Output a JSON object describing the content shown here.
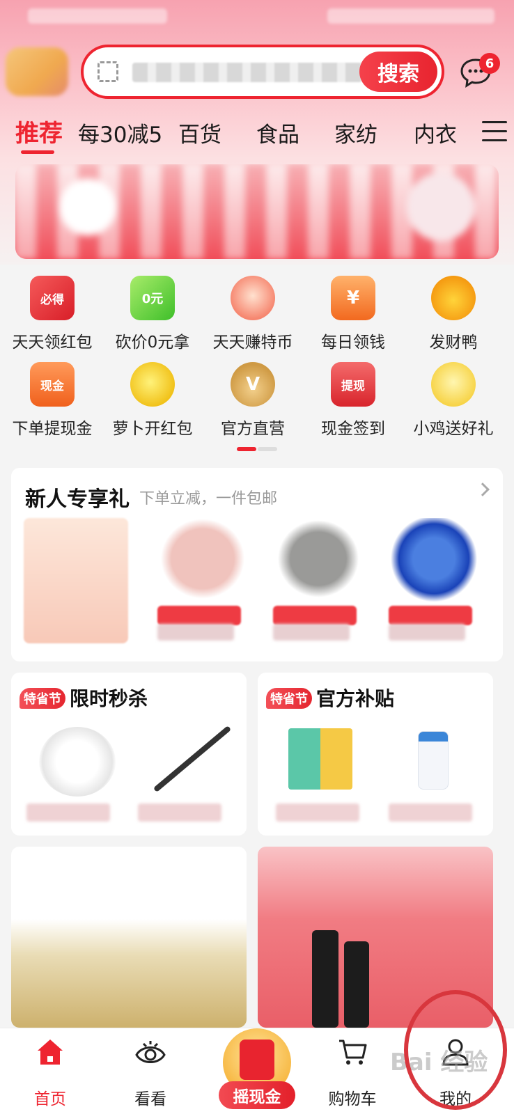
{
  "search": {
    "button_label": "搜索"
  },
  "messages": {
    "badge_count": "6"
  },
  "categories": [
    {
      "label": "推荐",
      "active": true
    },
    {
      "label": "每30减5",
      "active": false
    },
    {
      "label": "百货",
      "active": false
    },
    {
      "label": "食品",
      "active": false
    },
    {
      "label": "家纺",
      "active": false
    },
    {
      "label": "内衣",
      "active": false
    }
  ],
  "shortcuts": [
    {
      "label": "天天领红包",
      "icon": "red-envelope-icon",
      "badge": "必得"
    },
    {
      "label": "砍价0元拿",
      "icon": "zero-yuan-hand-icon",
      "badge": "0元"
    },
    {
      "label": "天天赚特币",
      "icon": "cat-coin-icon",
      "badge": ""
    },
    {
      "label": "每日领钱",
      "icon": "wallet-yuan-icon",
      "badge": "¥"
    },
    {
      "label": "发财鸭",
      "icon": "duck-icon",
      "badge": ""
    },
    {
      "label": "下单提现金",
      "icon": "cart-cash-icon",
      "badge": "现金"
    },
    {
      "label": "萝卜开红包",
      "icon": "carrot-envelope-icon",
      "badge": ""
    },
    {
      "label": "官方直营",
      "icon": "rabbit-v-icon",
      "badge": "V"
    },
    {
      "label": "现金签到",
      "icon": "withdraw-box-icon",
      "badge": "提现"
    },
    {
      "label": "小鸡送好礼",
      "icon": "chick-icon",
      "badge": ""
    }
  ],
  "newbie": {
    "title": "新人专享礼",
    "subtitle": "下单立减，一件包邮"
  },
  "flash_sale": {
    "badge": "特省节",
    "title": "限时秒杀"
  },
  "subsidy": {
    "badge": "特省节",
    "title": "官方补贴"
  },
  "tabbar": [
    {
      "label": "首页",
      "icon": "home-icon",
      "active": true
    },
    {
      "label": "看看",
      "icon": "eye-icon",
      "active": false
    },
    {
      "label": "摇现金",
      "icon": "shake-cash-icon",
      "active": false
    },
    {
      "label": "购物车",
      "icon": "cart-icon",
      "active": false
    },
    {
      "label": "我的",
      "icon": "user-icon",
      "active": false
    }
  ],
  "watermark": "Bai 经验",
  "colors": {
    "accent": "#ee2430",
    "text": "#222222"
  }
}
